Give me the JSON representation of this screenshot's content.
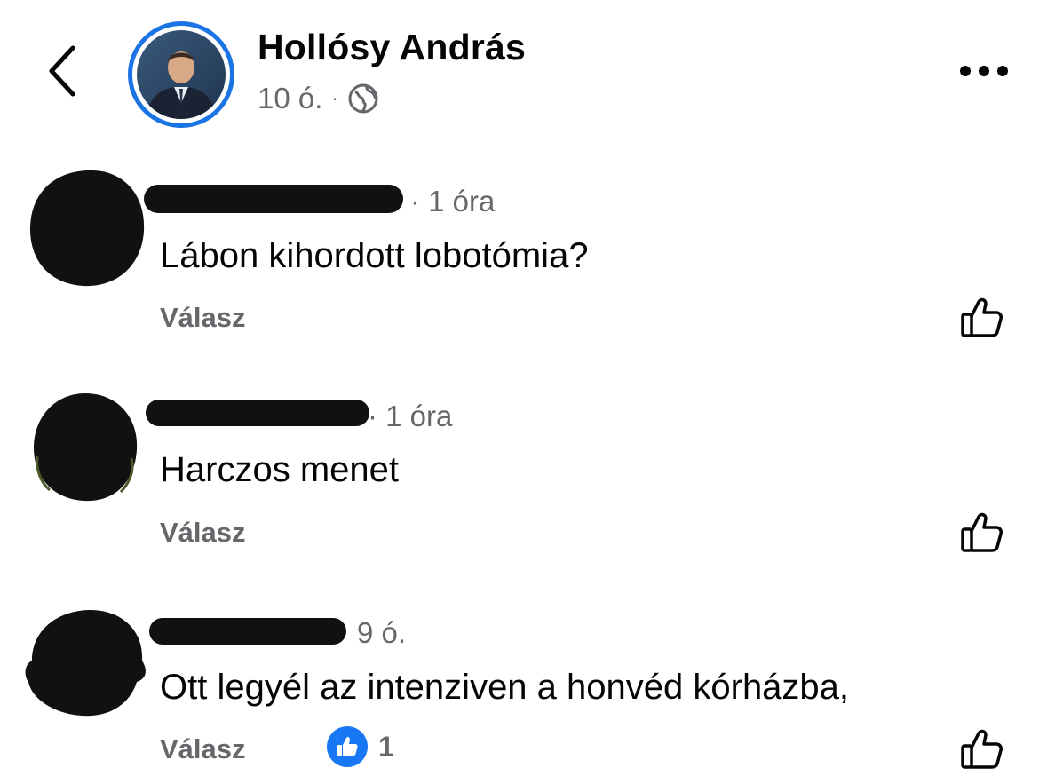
{
  "post": {
    "author_name": "Hollósy András",
    "time": "10 ó.",
    "separator": "·",
    "privacy_icon": "globe-icon",
    "back_icon": "chevron-left-icon",
    "more_icon": "more-horizontal-icon"
  },
  "comments": [
    {
      "time": "· 1 óra",
      "text": "Lábon kihordott lobotómia?",
      "reply_label": "Válasz",
      "like_icon": "thumbs-up-outline-icon"
    },
    {
      "time": "· 1 óra",
      "text": "Harczos menet",
      "reply_label": "Válasz",
      "like_icon": "thumbs-up-outline-icon"
    },
    {
      "time": "9 ó.",
      "text": "Ott legyél az intenziven a honvéd kórházba,",
      "reply_label": "Válasz",
      "reaction_count": "1",
      "reaction_icon": "like-reaction-icon",
      "like_icon": "thumbs-up-outline-icon"
    }
  ],
  "colors": {
    "accent": "#1b74e4",
    "reaction": "#1877f2",
    "secondary_text": "#65676b",
    "redaction": "#111111"
  }
}
